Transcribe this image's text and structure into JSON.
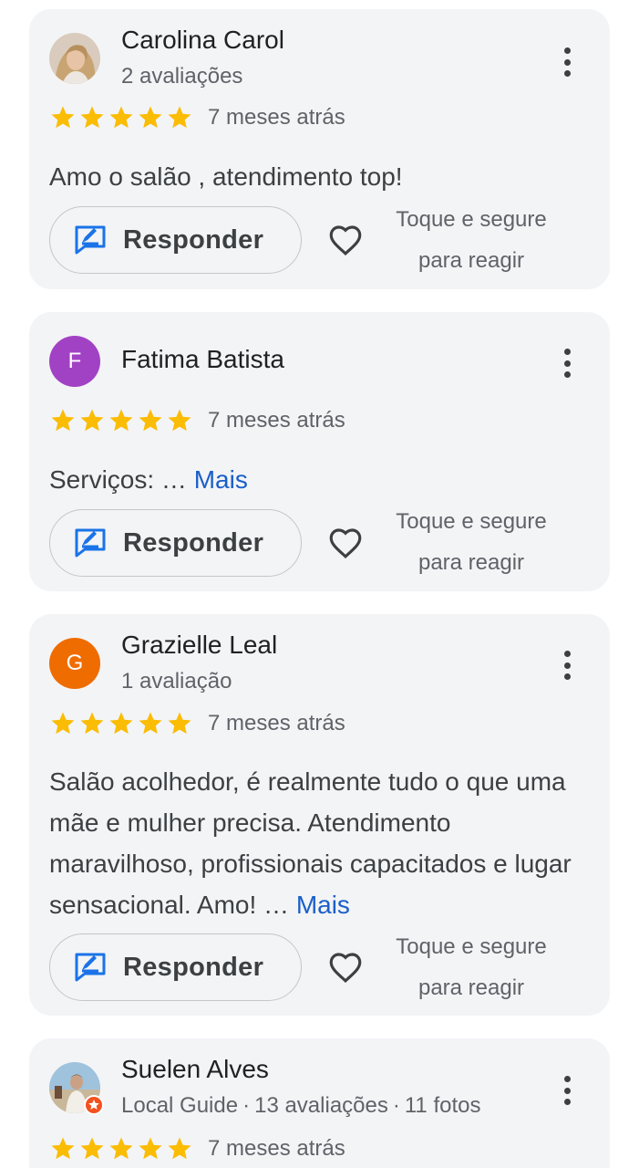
{
  "reviews": [
    {
      "name": "Carolina Carol",
      "meta": "2 avaliações",
      "time": "7 meses atrás",
      "text": "Amo o salão , atendimento top!",
      "more": "",
      "avatar_type": "photo"
    },
    {
      "name": "Fatima Batista",
      "meta": "",
      "time": "7 meses atrás",
      "text": "Serviços: …",
      "more": "Mais",
      "avatar_letter": "F",
      "avatar_color": "#a142c4"
    },
    {
      "name": "Grazielle Leal",
      "meta": "1 avaliação",
      "time": "7 meses atrás",
      "text": "Salão acolhedor, é realmente tudo o que uma mãe e mulher precisa. Atendimento maravilhoso, profissionais capacitados e lugar sensacional. Amo! …",
      "more": "Mais",
      "avatar_letter": "G",
      "avatar_color": "#ef6c00"
    },
    {
      "name": "Suelen Alves",
      "meta_parts": [
        "Local Guide",
        "13 avaliações",
        "11 fotos"
      ],
      "meta_sep": "·",
      "time": "7 meses atrás",
      "avatar_type": "photo-local-guide"
    }
  ],
  "actions": {
    "reply_label": "Responder",
    "react_hint_line1": "Toque e segure",
    "react_hint_line2": "para reagir"
  },
  "rating": {
    "stars": 5,
    "max": 5
  },
  "colors": {
    "star": "#fbbc04",
    "link": "#1a5fc9",
    "reply_icon": "#1a73e8",
    "local_guide_badge": "#f4511e"
  },
  "icons": {
    "reply": "reply-edit-icon",
    "heart": "heart-outline-icon",
    "menu": "more-vert-icon",
    "star": "star-icon"
  }
}
